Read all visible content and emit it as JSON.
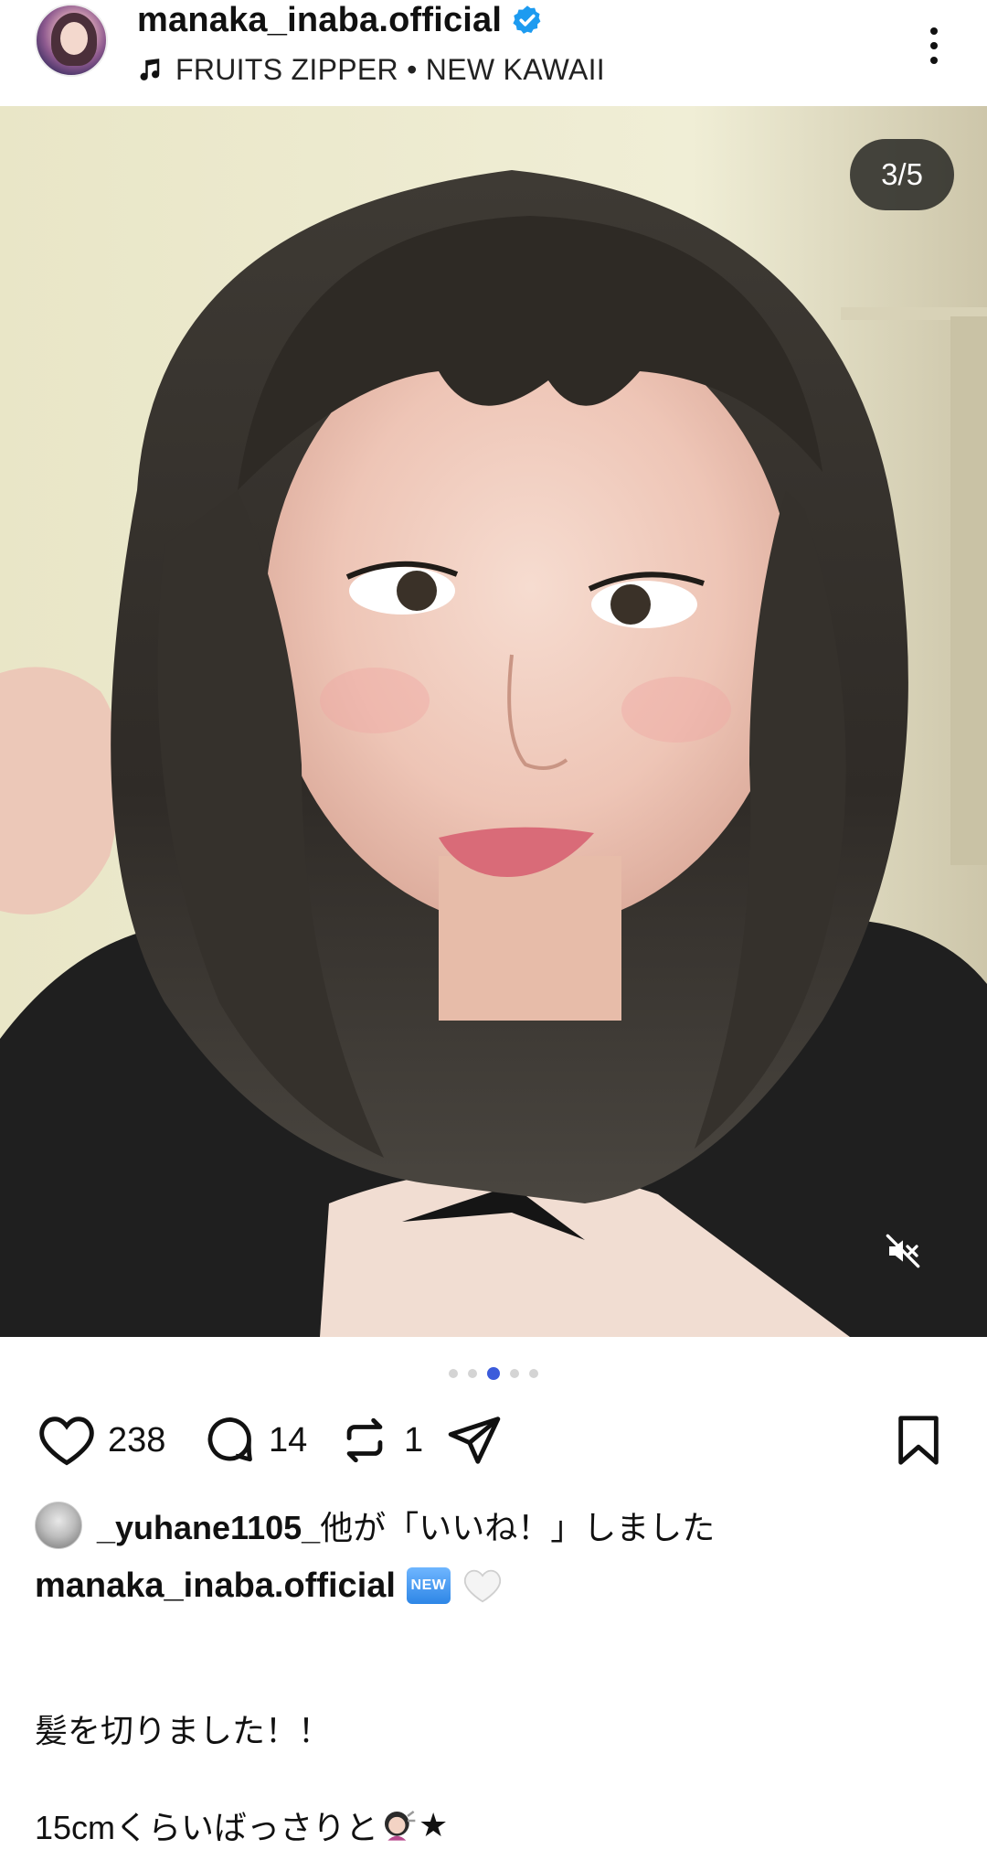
{
  "header": {
    "username": "manaka_inaba.official",
    "verified": true,
    "music": "FRUITS ZIPPER • NEW KAWAII",
    "icons": [
      "avatar",
      "verified-badge-icon",
      "music-note-icon",
      "more-vertical-icon"
    ]
  },
  "post": {
    "carousel_counter": "3/5",
    "carousel_index": 3,
    "carousel_total": 5,
    "mute_icon": "speaker-muted-icon"
  },
  "actions": {
    "likes": "238",
    "comments": "14",
    "reposts": "1",
    "icons": [
      "heart-icon",
      "comment-icon",
      "repost-icon",
      "share-send-icon",
      "bookmark-icon"
    ]
  },
  "liked_by": {
    "user": "_yuhane1105_",
    "text": "他が「いいね！」しました"
  },
  "caption": {
    "user": "manaka_inaba.official",
    "badge": "NEW",
    "line2": "髪を切りました！！",
    "line3": "15cmくらいばっさりと",
    "line3_suffix": "★"
  },
  "colors": {
    "accent": "#3b5bdb",
    "verified": "#1d9bf0",
    "text": "#111111",
    "pill_bg": "#2a2a26"
  }
}
